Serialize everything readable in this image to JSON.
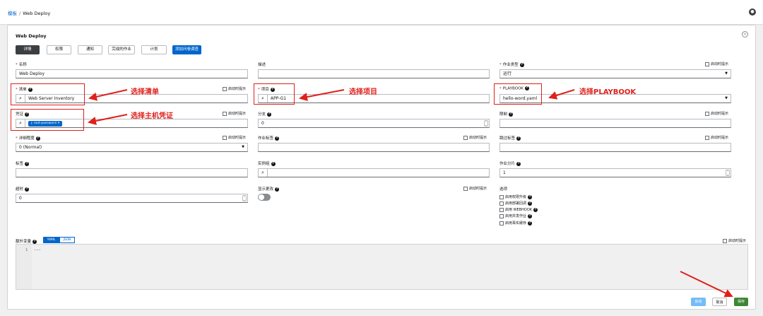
{
  "breadcrumb": {
    "parent": "模板",
    "separator": "/",
    "current": "Web Deploy"
  },
  "user": {
    "icon": "user-icon"
  },
  "card": {
    "title": "Web Deploy"
  },
  "tabs": [
    {
      "label": "详情",
      "active": true
    },
    {
      "label": "权限"
    },
    {
      "label": "通知"
    },
    {
      "label": "完成的作业"
    },
    {
      "label": "计划"
    },
    {
      "label": "添加问卷调查",
      "primary": true
    }
  ],
  "launch_prompt": "启动时提示",
  "fields": {
    "name": {
      "label": "名称",
      "value": "Web Deploy"
    },
    "description": {
      "label": "描述",
      "value": ""
    },
    "job_type": {
      "label": "作业类型",
      "value": "运行"
    },
    "inventory": {
      "label": "清单",
      "value": "Web Server Inventory"
    },
    "project": {
      "label": "项目",
      "value": "APP-G1"
    },
    "playbook": {
      "label": "PLAYBOOK",
      "value": "hello-word.yaml"
    },
    "credential": {
      "label": "凭证",
      "chip": "root-password"
    },
    "branch": {
      "label": "分支",
      "value": "0"
    },
    "limit": {
      "label": "限制",
      "value": ""
    },
    "verbosity": {
      "label": "详细程度",
      "value": "0 (Normal)"
    },
    "job_tags": {
      "label": "作业标签",
      "value": ""
    },
    "skip_tags": {
      "label": "跳过标签",
      "value": ""
    },
    "labels": {
      "label": "标签",
      "value": ""
    },
    "instance_groups": {
      "label": "实例组",
      "value": ""
    },
    "job_slicing": {
      "label": "作业分片",
      "value": "1"
    },
    "timeout": {
      "label": "超时",
      "value": "0"
    },
    "show_changes": {
      "label": "显示更改",
      "on": false
    },
    "options": {
      "label": "选项",
      "items": [
        "启用权限升级",
        "启用部署回调",
        "启用 WEBHOOK",
        "启用并发作业",
        "启用事实缓存"
      ]
    }
  },
  "extra_vars": {
    "label": "额外变量",
    "modes": [
      "YAML",
      "JSON"
    ],
    "active_mode": "YAML",
    "line_number": "1",
    "code": "---"
  },
  "annotations": {
    "inventory": "选择清单",
    "project": "选择项目",
    "playbook": "选择PLAYBOOK",
    "credential": "选择主机凭证",
    "color": "#e0201b"
  },
  "buttons": {
    "launch": "启动",
    "cancel": "取消",
    "save": "保存"
  },
  "colors": {
    "primary": "#0066cc",
    "save": "#3e8635",
    "launch": "#73bcf7",
    "required": "#c9190b"
  }
}
